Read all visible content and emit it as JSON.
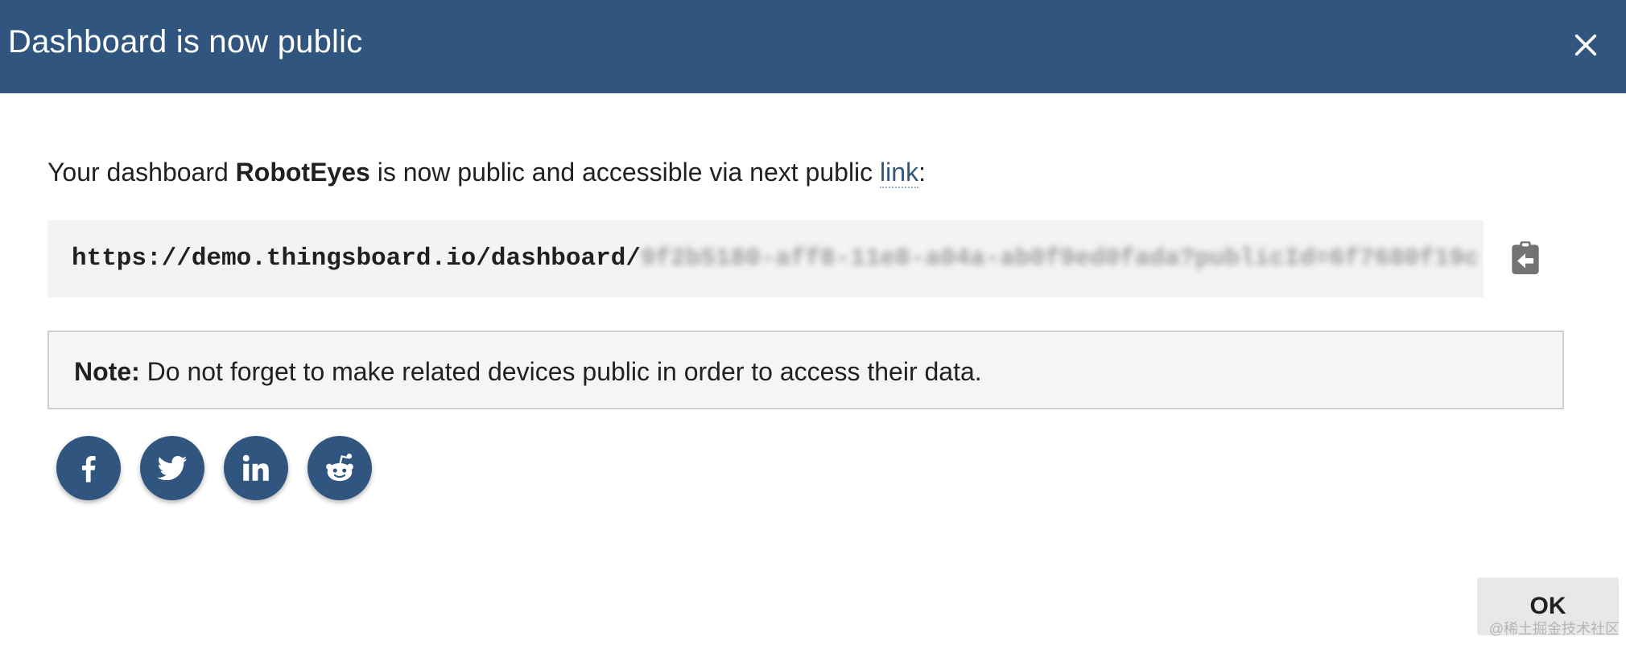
{
  "dialog": {
    "title": "Dashboard is now public",
    "close_icon": "close-icon"
  },
  "message": {
    "prefix": "Your dashboard ",
    "dashboard_name": "RobotEyes",
    "middle": " is now public and accessible via next public ",
    "link_text": "link",
    "suffix": ":"
  },
  "public_url": {
    "visible": "https://demo.thingsboard.io/dashboard/",
    "obscured": "9f2b5180-aff8-11e8-a04a-ab0f9ed0fada?publicId=6f7680f19c",
    "copy_icon": "clipboard-copy-icon"
  },
  "note": {
    "label": "Note:",
    "text": " Do not forget to make related devices public in order to access their data."
  },
  "share_buttons": [
    {
      "network": "facebook",
      "icon": "facebook-icon"
    },
    {
      "network": "twitter",
      "icon": "twitter-icon"
    },
    {
      "network": "linkedin",
      "icon": "linkedin-icon"
    },
    {
      "network": "reddit",
      "icon": "reddit-icon"
    }
  ],
  "actions": {
    "ok_label": "OK"
  },
  "watermark": "@稀土掘金技术社区",
  "colors": {
    "toolbar": "#305680",
    "share_button": "#305680",
    "link": "#305680"
  }
}
